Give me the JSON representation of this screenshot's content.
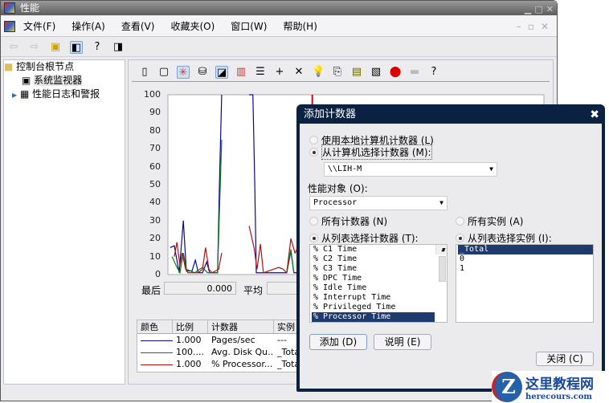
{
  "window": {
    "title": "性能"
  },
  "menu": [
    "文件(F)",
    "操作(A)",
    "查看(V)",
    "收藏夹(O)",
    "窗口(W)",
    "帮助(H)"
  ],
  "tree": {
    "root": "控制台根节点",
    "items": [
      "系统监视器",
      "性能日志和警报"
    ]
  },
  "stats": {
    "last_label": "最后",
    "last_value": "0.000",
    "avg_label": "平均"
  },
  "legend": {
    "headers": [
      "颜色",
      "比例",
      "计数器",
      "实例"
    ],
    "rows": [
      {
        "color": "#0a0a8c",
        "scale": "1.000",
        "counter": "Pages/sec",
        "instance": "---"
      },
      {
        "color": "#0a7a1a",
        "scale": "100....",
        "counter": "Avg. Disk Qu...",
        "instance": "_Tota"
      },
      {
        "color": "#b01010",
        "scale": "1.000",
        "counter": "% Processor...",
        "instance": "_Tota"
      }
    ]
  },
  "chart_data": {
    "type": "line",
    "ylim": [
      0,
      100
    ],
    "xlim": [
      0,
      100
    ],
    "yticks": [
      "100",
      "90",
      "80",
      "70",
      "60",
      "50",
      "40",
      "30",
      "20",
      "10",
      "0"
    ],
    "grid": false,
    "series": [
      {
        "name": "Pages/sec",
        "color": "#0a0a8c",
        "x": [
          0.6,
          1.7,
          3,
          4.1,
          4.9,
          6.4,
          7.3,
          8.1,
          9.2,
          10.3,
          11.1,
          13.2,
          13.7,
          14.3,
          null,
          21.6,
          22.6,
          23.1,
          23.5,
          31.6,
          32.7,
          33.5,
          34.8
        ],
        "y": [
          15,
          16,
          1,
          30,
          2,
          2,
          8,
          1,
          1,
          7,
          1,
          1,
          50,
          100,
          null,
          100,
          100,
          50,
          1,
          1,
          13,
          1,
          1
        ]
      },
      {
        "name": "Avg. Disk Queue Length",
        "color": "#0a7a1a",
        "x": [
          1.1,
          2.4,
          3.2,
          4.1,
          4.9,
          7.1,
          9.2,
          10.5,
          13.2,
          14.3,
          null,
          31.6,
          32.7,
          33.5
        ],
        "y": [
          10,
          4,
          1,
          12,
          3,
          1,
          4,
          1,
          1,
          75,
          null,
          1,
          14,
          1
        ]
      },
      {
        "name": "% Processor Time",
        "color": "#b01010",
        "x": [
          1.7,
          2.4,
          3.2,
          3.8,
          4.7,
          5.3,
          8.1,
          9.2,
          10,
          10.9,
          11.8,
          13.5,
          14.3,
          null,
          21.6,
          22.9,
          23.7,
          24.6,
          25.4,
          29.5,
          30.6,
          31.6,
          32.7,
          33.8,
          34.8
        ],
        "y": [
          10,
          18,
          5,
          12,
          3,
          1,
          1,
          3,
          15,
          3,
          1,
          3,
          12,
          null,
          27,
          15,
          3,
          17,
          1,
          4,
          3,
          1,
          20,
          12,
          16
        ]
      }
    ],
    "time_bar": 38.4
  },
  "dialog": {
    "title": "添加计数器",
    "close": "✖",
    "local_radio": "使用本地计算机计数器 (L)",
    "remote_radio": "从计算机选择计数器 (M):",
    "computer": "\\\\LIH-M",
    "object_label": "性能对象 (O):",
    "object": "Processor",
    "all_counters": "所有计数器 (N)",
    "list_counters": "从列表选择计数器 (T):",
    "all_instances": "所有实例 (A)",
    "list_instances": "从列表选择实例 (I):",
    "counters": [
      "% C1 Time",
      "% C2 Time",
      "% C3 Time",
      "% DPC Time",
      "% Idle Time",
      "% Interrupt Time",
      "% Privileged Time",
      "% Processor Time"
    ],
    "instances": [
      "_Total",
      "0",
      "1"
    ],
    "add": "添加 (D)",
    "explain": "说明 (E)",
    "closebtn": "关闭 (C)"
  },
  "watermark": {
    "title": "这里教程网",
    "url": "herecours.com"
  }
}
